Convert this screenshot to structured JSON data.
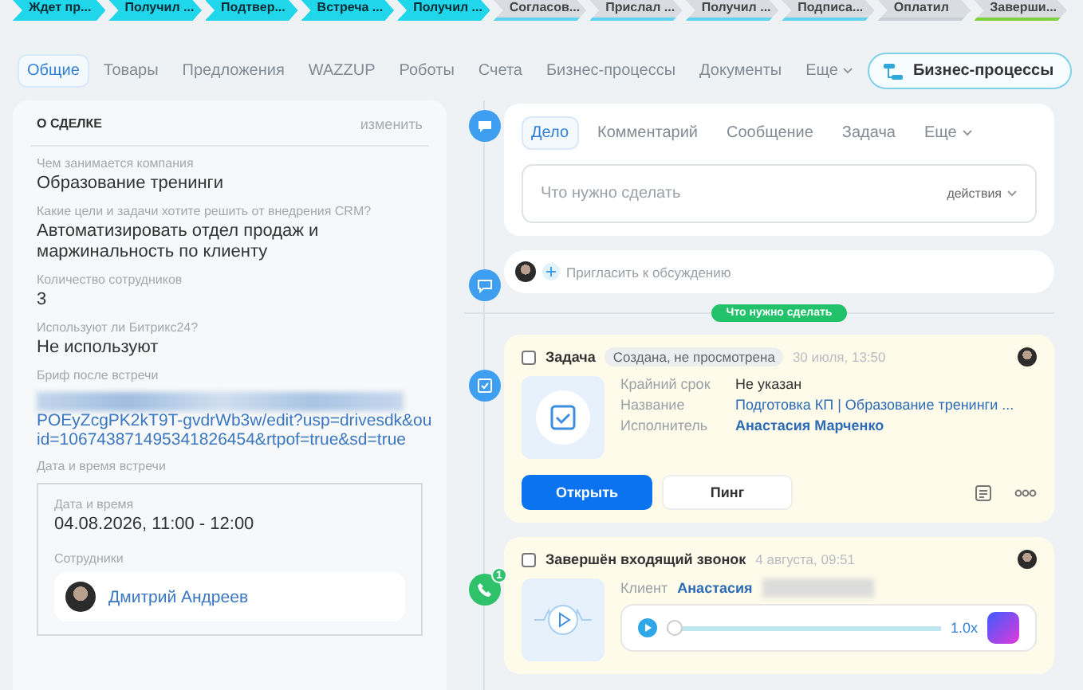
{
  "stages": [
    {
      "label": "Ждет пр...",
      "done": true,
      "color": "#1fd6ea"
    },
    {
      "label": "Получил ...",
      "done": true,
      "color": "#1fd6ea"
    },
    {
      "label": "Подтвер...",
      "done": true,
      "color": "#1fd6ea"
    },
    {
      "label": "Встреча ...",
      "done": true,
      "color": "#1fd6ea"
    },
    {
      "label": "Получил ...",
      "done": true,
      "color": "#1fd6ea"
    },
    {
      "label": "Согласов...",
      "done": false,
      "color": "#5fd3ee"
    },
    {
      "label": "Прислал ...",
      "done": false,
      "color": "#5fd3ee"
    },
    {
      "label": "Получил ...",
      "done": false,
      "color": "#5fd3ee"
    },
    {
      "label": "Подписа...",
      "done": false,
      "color": "#5fd3ee"
    },
    {
      "label": "Оплатил",
      "done": false,
      "color": "#c9ced4"
    },
    {
      "label": "Заверши...",
      "done": false,
      "color": "#7fd13b"
    }
  ],
  "tabs": [
    {
      "label": "Общие",
      "selected": true
    },
    {
      "label": "Товары",
      "selected": false
    },
    {
      "label": "Предложения",
      "selected": false
    },
    {
      "label": "WAZZUP",
      "selected": false
    },
    {
      "label": "Роботы",
      "selected": false
    },
    {
      "label": "Счета",
      "selected": false
    },
    {
      "label": "Бизнес-процессы",
      "selected": false
    },
    {
      "label": "Документы",
      "selected": false
    },
    {
      "label": "Еще",
      "selected": false,
      "kind": "more"
    }
  ],
  "process_button": "Бизнес-процессы",
  "deal": {
    "title": "О СДЕЛКЕ",
    "edit": "изменить",
    "fields": [
      {
        "label": "Чем занимается компания",
        "value": "Образование тренинги"
      },
      {
        "label": "Какие цели и задачи хотите решить от внедрения CRM?",
        "value": "Автоматизировать отдел продаж и маржинальность по клиенту"
      },
      {
        "label": "Количество сотрудников",
        "value": "3"
      },
      {
        "label": "Используют ли Битрикс24?",
        "value": "Не используют"
      }
    ],
    "brief": {
      "label": "Бриф после встречи",
      "link": "POEyZcgPK2kT9T-gvdrWb3w/edit?usp=drivesdk&ouid=106743871495341826454&rtpof=true&sd=true"
    },
    "meeting": {
      "label": "Дата и время встречи",
      "datetime_label": "Дата и время",
      "datetime": "04.08.2026, 11:00 - 12:00",
      "staff_label": "Сотрудники",
      "staff": "Дмитрий Андреев"
    }
  },
  "composer": {
    "tabs": [
      {
        "label": "Дело",
        "selected": true
      },
      {
        "label": "Комментарий",
        "selected": false
      },
      {
        "label": "Сообщение",
        "selected": false
      },
      {
        "label": "Задача",
        "selected": false
      },
      {
        "label": "Еще",
        "selected": false,
        "kind": "more"
      }
    ],
    "placeholder": "Что нужно сделать",
    "actions": "действия"
  },
  "invite": {
    "placeholder": "Пригласить к обсуждению"
  },
  "divider_label": "Что нужно сделать",
  "task": {
    "checked": false,
    "title": "Задача",
    "status": "Создана, не просмотрена",
    "date": "30 июля, 13:50",
    "rows": [
      {
        "label": "Крайний срок",
        "value": "Не указан",
        "kind": "plain"
      },
      {
        "label": "Название",
        "value": "Подготовка КП | Образование тренинги ...",
        "kind": "link"
      },
      {
        "label": "Исполнитель",
        "value": "Анастасия Марченко",
        "kind": "person"
      }
    ],
    "open": "Открыть",
    "ping": "Пинг"
  },
  "call": {
    "checked": false,
    "badge": "1",
    "title": "Завершён входящий звонок",
    "date": "4 августа, 09:51",
    "client_label": "Клиент",
    "client": "Анастасия",
    "speed": "1.0x",
    "level": 0.03
  }
}
